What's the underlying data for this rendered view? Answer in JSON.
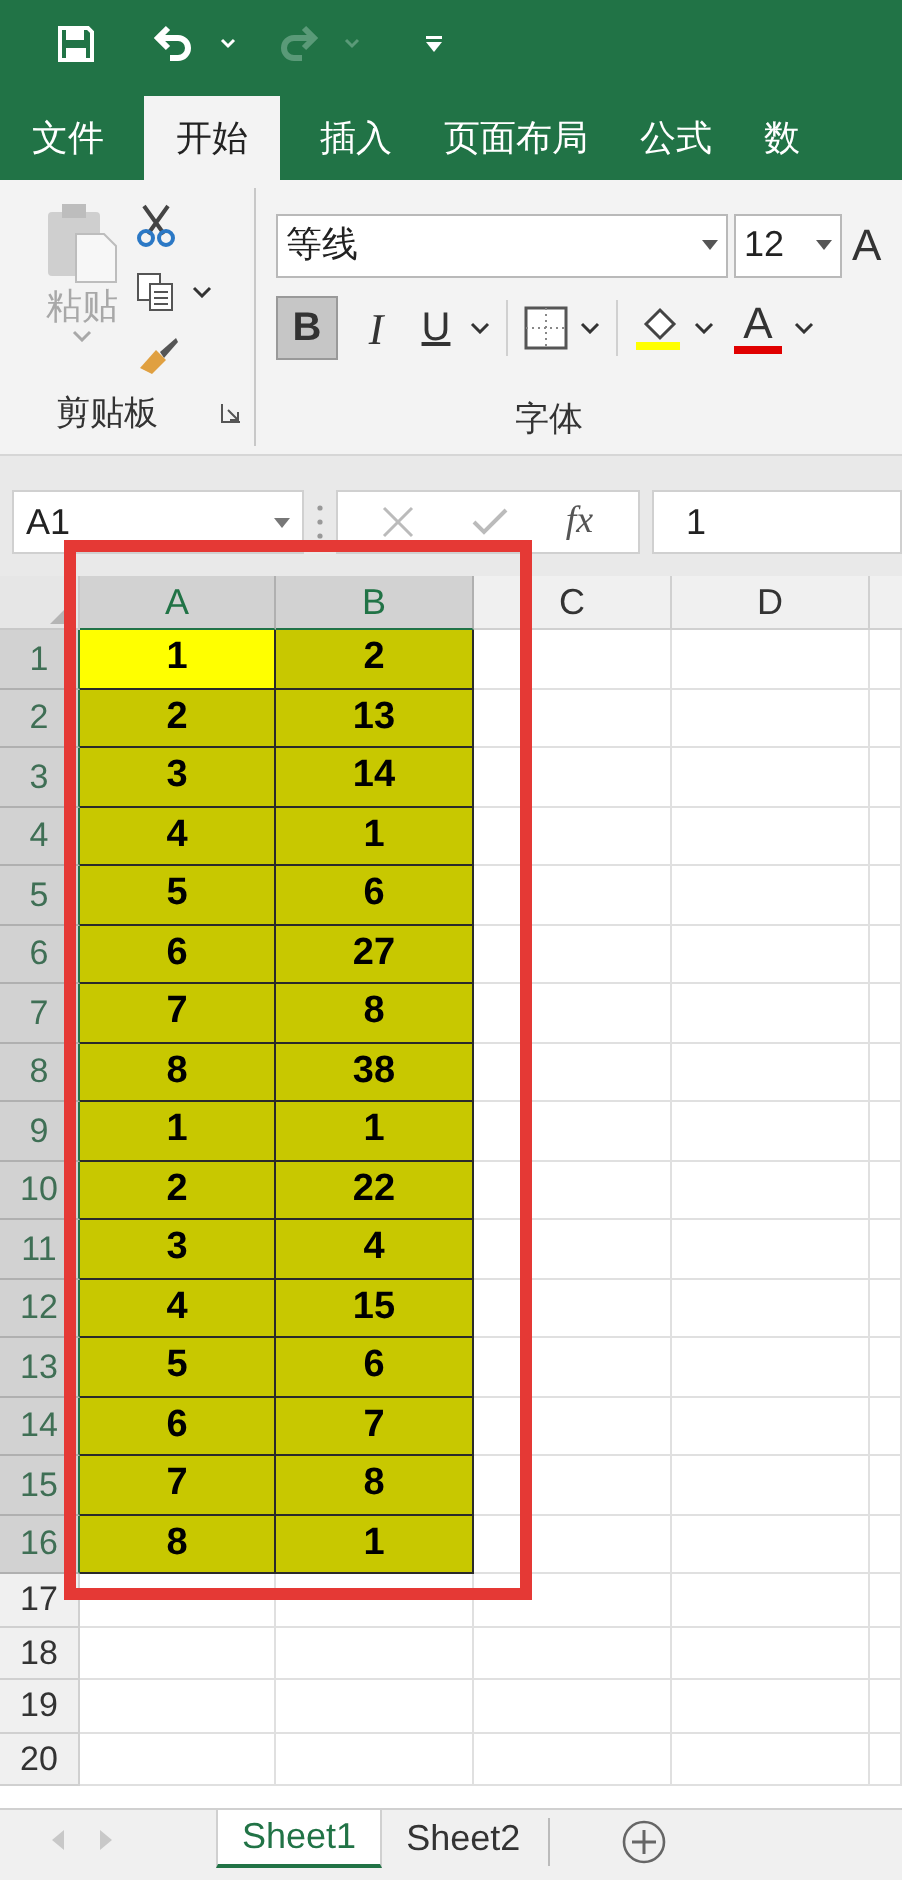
{
  "ribbon_tabs": [
    {
      "label": "文件",
      "selected": false
    },
    {
      "label": "开始",
      "selected": true
    },
    {
      "label": "插入",
      "selected": false
    },
    {
      "label": "页面布局",
      "selected": false
    },
    {
      "label": "公式",
      "selected": false
    },
    {
      "label": "数",
      "selected": false
    }
  ],
  "clipboard": {
    "paste_label": "粘贴",
    "group_label": "剪贴板"
  },
  "font": {
    "name": "等线",
    "size": "12",
    "grow_label": "A",
    "bold_label": "B",
    "bold_selected": true,
    "italic_label": "I",
    "underline_label": "U",
    "color_label": "A",
    "group_label": "字体"
  },
  "name_box": "A1",
  "fx_label": "fx",
  "formula": "1",
  "columns": [
    {
      "label": "A",
      "selected": true
    },
    {
      "label": "B",
      "selected": true
    },
    {
      "label": "C",
      "selected": false
    },
    {
      "label": "D",
      "selected": false
    }
  ],
  "rows": [
    {
      "number": "1",
      "selected": true,
      "cells": [
        {
          "value": "1",
          "color": "#ffff00"
        },
        {
          "value": "2",
          "color": "#c8c800"
        }
      ]
    },
    {
      "number": "2",
      "selected": true,
      "cells": [
        {
          "value": "2",
          "color": "#c8c800"
        },
        {
          "value": "13",
          "color": "#c8c800"
        }
      ]
    },
    {
      "number": "3",
      "selected": true,
      "cells": [
        {
          "value": "3",
          "color": "#c8c800"
        },
        {
          "value": "14",
          "color": "#c8c800"
        }
      ]
    },
    {
      "number": "4",
      "selected": true,
      "cells": [
        {
          "value": "4",
          "color": "#c8c800"
        },
        {
          "value": "1",
          "color": "#c8c800"
        }
      ]
    },
    {
      "number": "5",
      "selected": true,
      "cells": [
        {
          "value": "5",
          "color": "#c8c800"
        },
        {
          "value": "6",
          "color": "#c8c800"
        }
      ]
    },
    {
      "number": "6",
      "selected": true,
      "cells": [
        {
          "value": "6",
          "color": "#c8c800"
        },
        {
          "value": "27",
          "color": "#c8c800"
        }
      ]
    },
    {
      "number": "7",
      "selected": true,
      "cells": [
        {
          "value": "7",
          "color": "#c8c800"
        },
        {
          "value": "8",
          "color": "#c8c800"
        }
      ]
    },
    {
      "number": "8",
      "selected": true,
      "cells": [
        {
          "value": "8",
          "color": "#c8c800"
        },
        {
          "value": "38",
          "color": "#c8c800"
        }
      ]
    },
    {
      "number": "9",
      "selected": true,
      "cells": [
        {
          "value": "1",
          "color": "#c8c800"
        },
        {
          "value": "1",
          "color": "#c8c800"
        }
      ]
    },
    {
      "number": "10",
      "selected": true,
      "cells": [
        {
          "value": "2",
          "color": "#c8c800"
        },
        {
          "value": "22",
          "color": "#c8c800"
        }
      ]
    },
    {
      "number": "11",
      "selected": true,
      "cells": [
        {
          "value": "3",
          "color": "#c8c800"
        },
        {
          "value": "4",
          "color": "#c8c800"
        }
      ]
    },
    {
      "number": "12",
      "selected": true,
      "cells": [
        {
          "value": "4",
          "color": "#c8c800"
        },
        {
          "value": "15",
          "color": "#c8c800"
        }
      ]
    },
    {
      "number": "13",
      "selected": true,
      "cells": [
        {
          "value": "5",
          "color": "#c8c800"
        },
        {
          "value": "6",
          "color": "#c8c800"
        }
      ]
    },
    {
      "number": "14",
      "selected": true,
      "cells": [
        {
          "value": "6",
          "color": "#c8c800"
        },
        {
          "value": "7",
          "color": "#c8c800"
        }
      ]
    },
    {
      "number": "15",
      "selected": true,
      "cells": [
        {
          "value": "7",
          "color": "#c8c800"
        },
        {
          "value": "8",
          "color": "#c8c800"
        }
      ]
    },
    {
      "number": "16",
      "selected": true,
      "cells": [
        {
          "value": "8",
          "color": "#c8c800"
        },
        {
          "value": "1",
          "color": "#c8c800"
        }
      ]
    },
    {
      "number": "17",
      "selected": false,
      "cells": []
    },
    {
      "number": "18",
      "selected": false,
      "cells": []
    },
    {
      "number": "19",
      "selected": false,
      "cells": []
    },
    {
      "number": "20",
      "selected": false,
      "cells": []
    }
  ],
  "sheet_tabs": [
    {
      "label": "Sheet1",
      "selected": true
    },
    {
      "label": "Sheet2",
      "selected": false
    }
  ]
}
